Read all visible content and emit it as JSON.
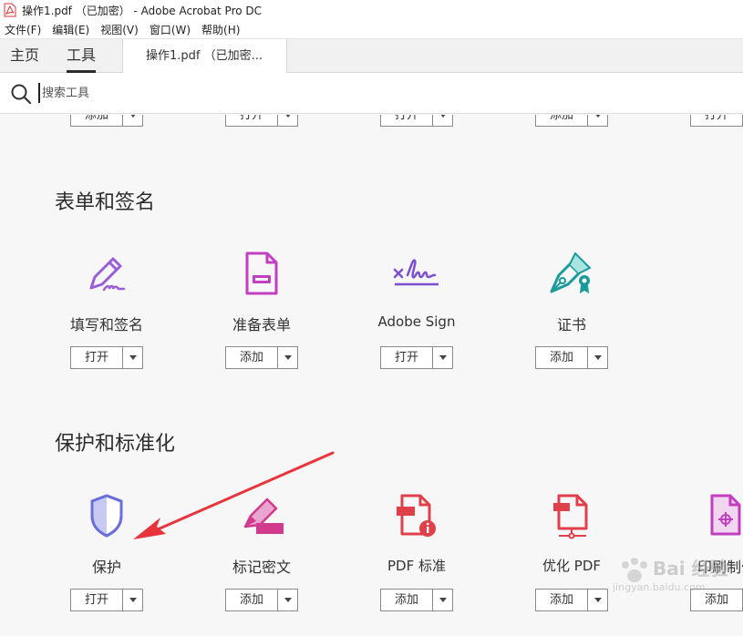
{
  "window": {
    "title": "操作1.pdf （已加密） - Adobe Acrobat Pro DC"
  },
  "menubar": {
    "items": [
      {
        "label": "文件(F)"
      },
      {
        "label": "编辑(E)"
      },
      {
        "label": "视图(V)"
      },
      {
        "label": "窗口(W)"
      },
      {
        "label": "帮助(H)"
      }
    ]
  },
  "tabs": {
    "home": "主页",
    "tools": "工具",
    "document": "操作1.pdf （已加密..."
  },
  "search": {
    "placeholder": "搜索工具"
  },
  "top_row": {
    "buttons": [
      "添加",
      "打开",
      "打开",
      "添加",
      "打开"
    ]
  },
  "sections": [
    {
      "title": "表单和签名",
      "tools": [
        {
          "name": "填写和签名",
          "button": "打开",
          "icon": "fill-sign-icon",
          "color": "#9a5fd6"
        },
        {
          "name": "准备表单",
          "button": "添加",
          "icon": "prepare-form-icon",
          "color": "#c23fc0"
        },
        {
          "name": "Adobe Sign",
          "button": "打开",
          "icon": "adobe-sign-icon",
          "color": "#7b4fd0"
        },
        {
          "name": "证书",
          "button": "添加",
          "icon": "certificate-icon",
          "color": "#1a9a9a"
        }
      ]
    },
    {
      "title": "保护和标准化",
      "tools": [
        {
          "name": "保护",
          "button": "打开",
          "icon": "protect-shield-icon",
          "color": "#6b6fd8"
        },
        {
          "name": "标记密文",
          "button": "添加",
          "icon": "redact-icon",
          "color": "#d23a8c"
        },
        {
          "name": "PDF 标准",
          "button": "添加",
          "icon": "pdf-standards-icon",
          "color": "#e0404a"
        },
        {
          "name": "优化 PDF",
          "button": "添加",
          "icon": "optimize-pdf-icon",
          "color": "#e0404a"
        },
        {
          "name": "印刷制作",
          "button": "添加",
          "icon": "print-production-icon",
          "color": "#c23fc0"
        }
      ]
    }
  ],
  "watermark": {
    "text": "Bai 经验",
    "url_text": "jingyan.baidu.com"
  },
  "colors": {
    "accent_arrow": "#e8343c",
    "tab_underline": "#2c2c2c"
  }
}
